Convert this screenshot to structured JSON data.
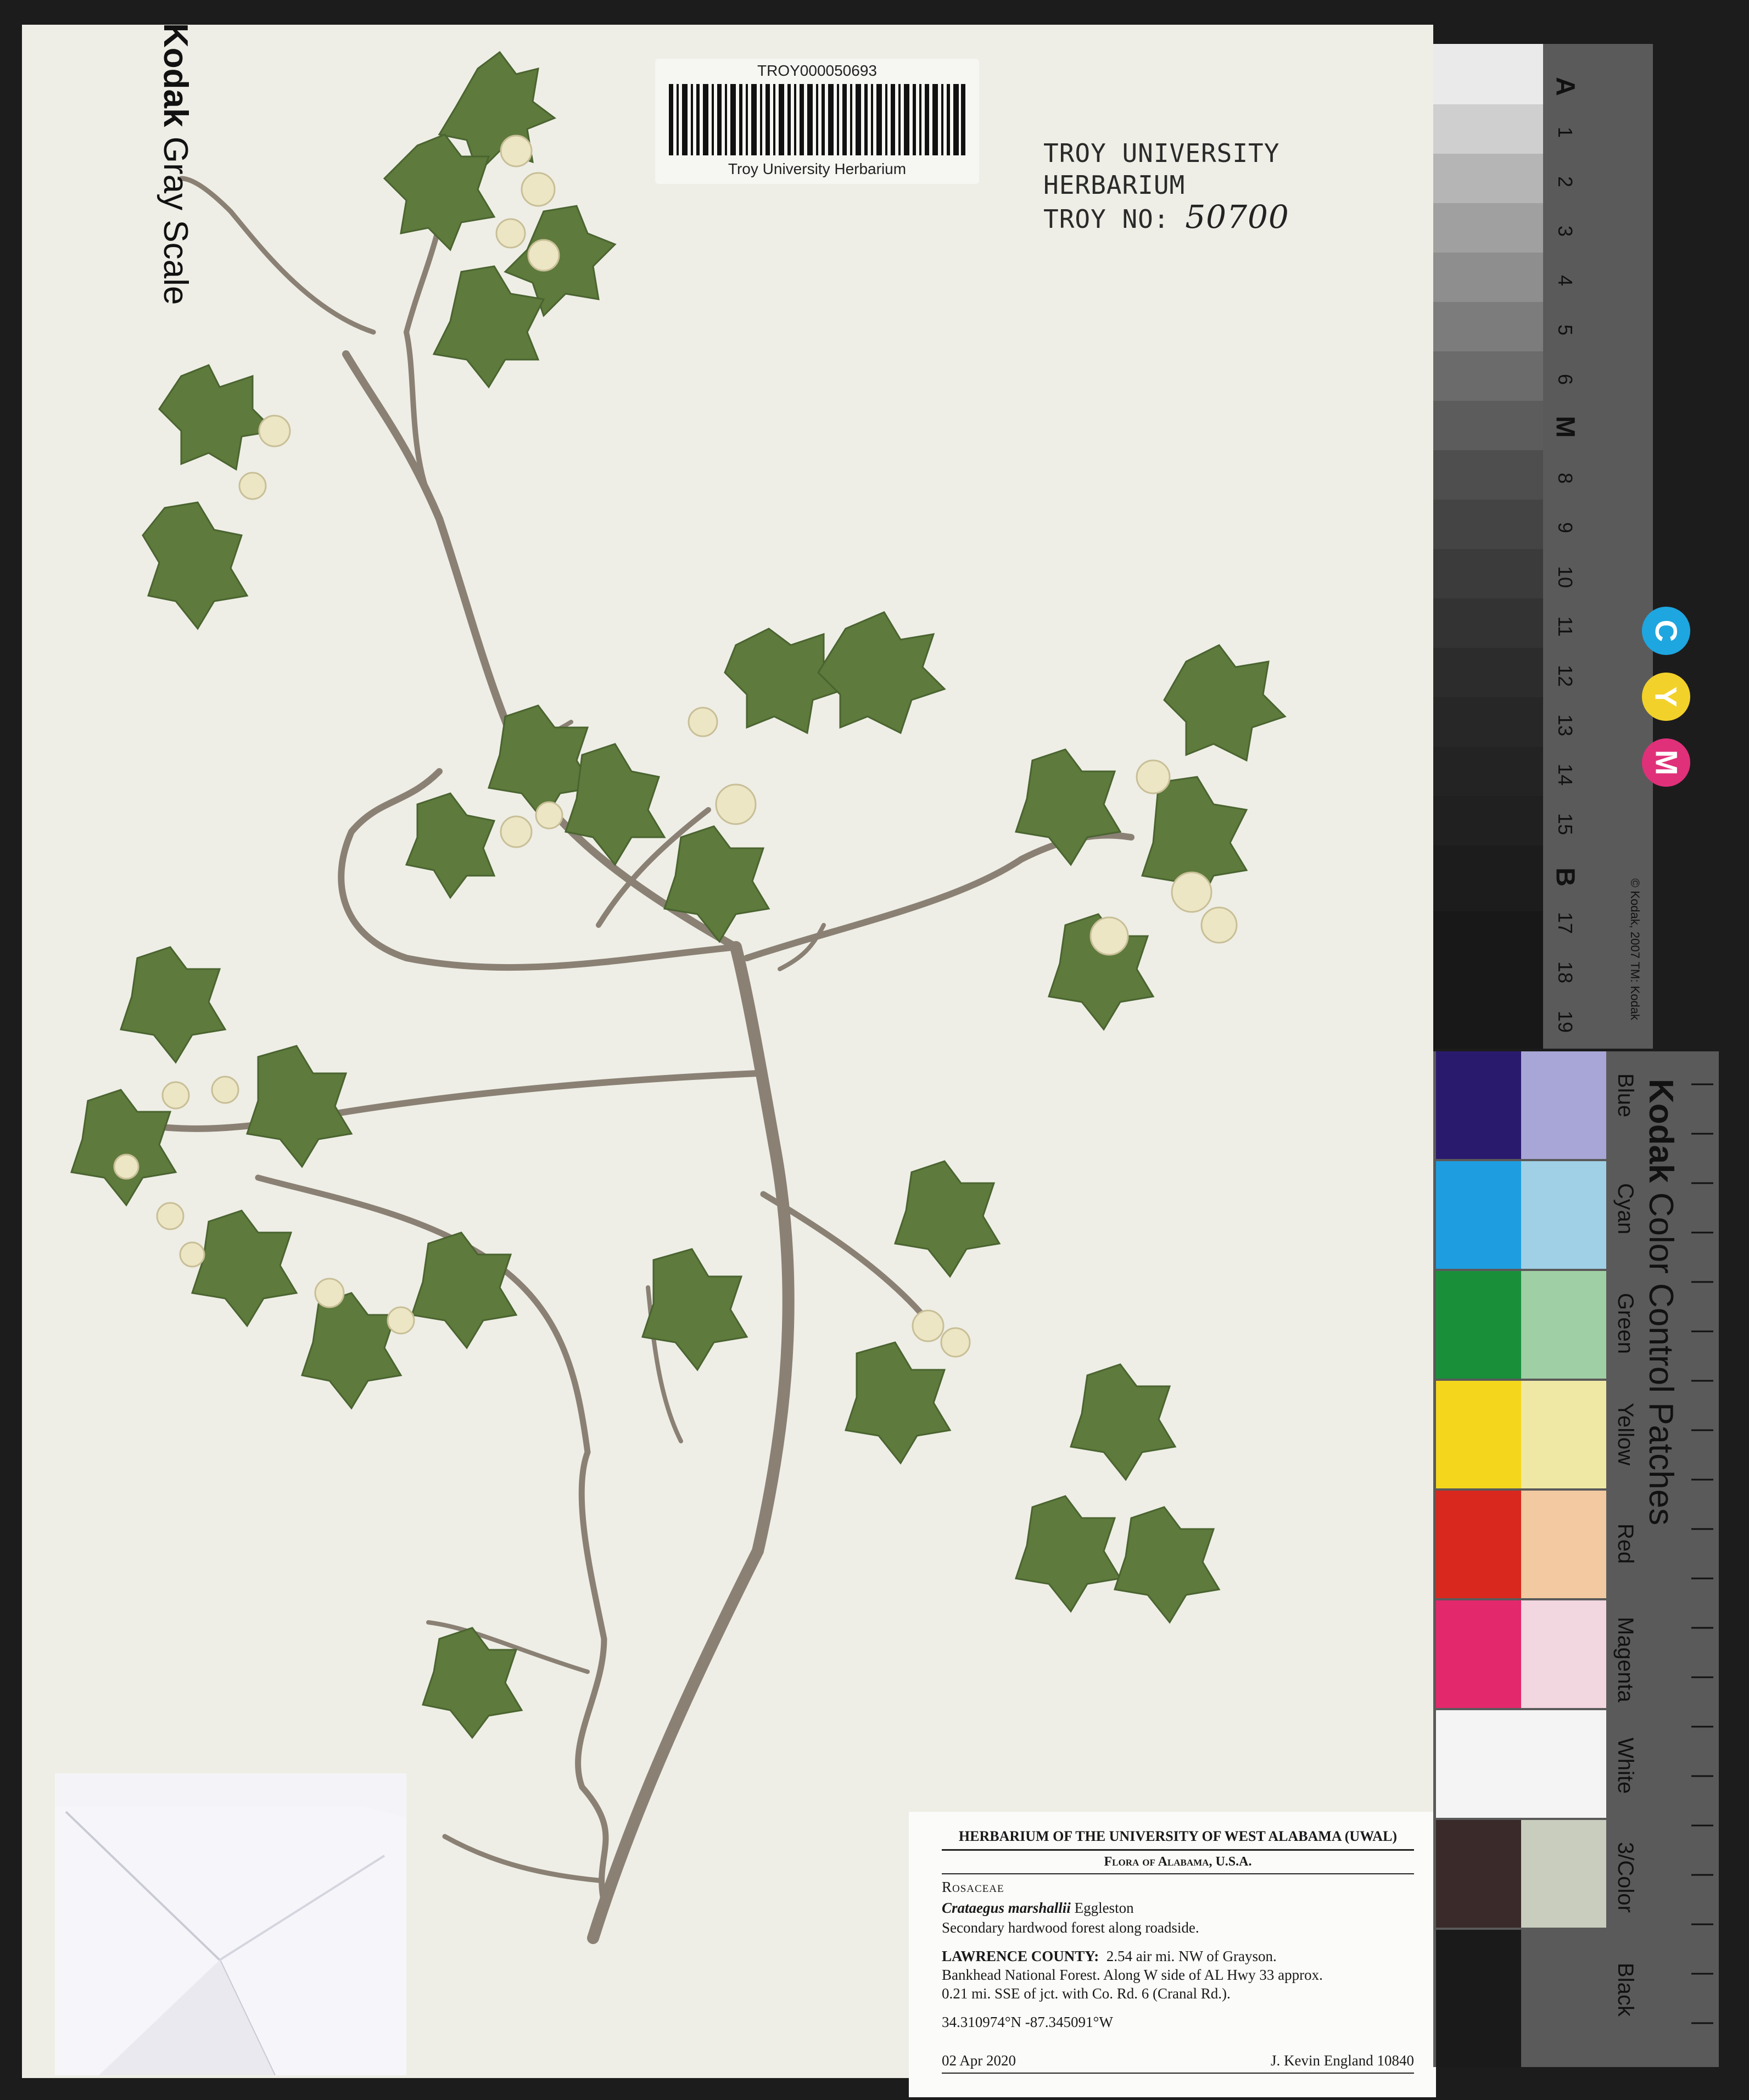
{
  "barcode": {
    "code": "TROY000050693",
    "institution": "Troy University Herbarium"
  },
  "herbarium_stamp": {
    "line1": "TROY UNIVERSITY HERBARIUM",
    "line2_prefix": "TROY NO:",
    "number": "50700"
  },
  "label": {
    "header": "HERBARIUM OF THE UNIVERSITY OF WEST ALABAMA (UWAL)",
    "subheader": "Flora of Alabama, U.S.A.",
    "family": "Rosaceae",
    "genus_species": "Crataegus marshallii",
    "authority": "Eggleston",
    "habitat": "Secondary hardwood forest along roadside.",
    "county": "LAWRENCE COUNTY:",
    "locality1": "2.54 air mi. NW of Grayson.",
    "locality2": "Bankhead National Forest. Along W side of AL Hwy 33 approx.",
    "locality3": "0.21 mi. SSE of jct. with Co. Rd. 6 (Cranal Rd.).",
    "coordinates": "34.310974°N -87.345091°W",
    "date": "02 Apr 2020",
    "collector": "J. Kevin England 10840"
  },
  "gray_scale": {
    "brand": "Kodak",
    "title": "Gray Scale",
    "marks": [
      "A",
      "1",
      "2",
      "3",
      "4",
      "5",
      "6",
      "M",
      "8",
      "9",
      "10",
      "11",
      "12",
      "13",
      "14",
      "15",
      "B",
      "17",
      "18",
      "19"
    ],
    "cmy": [
      "C",
      "Y",
      "M"
    ],
    "copyright": "© Kodak, 2007 TM: Kodak"
  },
  "color_patches": {
    "brand": "Kodak",
    "title": "Color Control Patches",
    "labels": [
      "Blue",
      "Cyan",
      "Green",
      "Yellow",
      "Red",
      "Magenta",
      "White",
      "3/Color",
      "Black"
    ],
    "copyright": "© Kodak, 2007 TM: Kodak"
  },
  "colors": {
    "sheet": "#eeeee6",
    "leaf": "#5e7a3c",
    "stem": "#8a8074",
    "flower": "#ede6c4"
  }
}
